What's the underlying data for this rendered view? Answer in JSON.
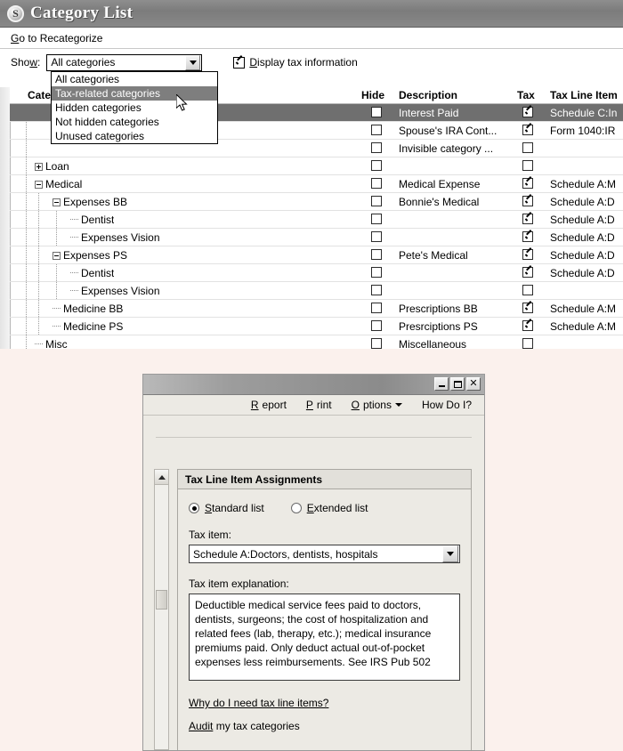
{
  "category_window": {
    "title": "Category List",
    "logo_icon": "quicken-s-logo-icon",
    "menu": {
      "recategorize_link": "Go to Recategorize"
    },
    "toolbar": {
      "show_label": "Show:",
      "show_value": "All categories",
      "display_tax_label": "Display tax information",
      "display_tax_checked": true,
      "dropdown_open": true,
      "dropdown_options": [
        "All categories",
        "Tax-related categories",
        "Hidden categories",
        "Not hidden categories",
        "Unused categories"
      ],
      "dropdown_selected": "Tax-related categories"
    },
    "grid": {
      "columns": [
        "Category",
        "Hide",
        "Description",
        "Tax",
        "Tax Line Item"
      ],
      "rows": [
        {
          "category": "",
          "indent": 0,
          "toggle": "none",
          "hide": false,
          "description": "Interest Paid",
          "tax": true,
          "tax_line_item": "Schedule C:In",
          "selected": true
        },
        {
          "category": "",
          "indent": 1,
          "toggle": "none",
          "hide": false,
          "description": "Spouse's IRA Cont...",
          "tax": true,
          "tax_line_item": "Form 1040:IR",
          "selected": false
        },
        {
          "category": "",
          "indent": 1,
          "toggle": "none",
          "hide": false,
          "description": "Invisible category ...",
          "tax": false,
          "tax_line_item": "",
          "selected": false
        },
        {
          "category": "Loan",
          "indent": 1,
          "toggle": "plus",
          "hide": false,
          "description": "",
          "tax": false,
          "tax_line_item": "",
          "selected": false
        },
        {
          "category": "Medical",
          "indent": 1,
          "toggle": "minus",
          "hide": false,
          "description": "Medical Expense",
          "tax": true,
          "tax_line_item": "Schedule A:M",
          "selected": false
        },
        {
          "category": "Expenses BB",
          "indent": 2,
          "toggle": "minus",
          "hide": false,
          "description": "Bonnie's Medical",
          "tax": true,
          "tax_line_item": "Schedule A:D",
          "selected": false
        },
        {
          "category": "Dentist",
          "indent": 3,
          "toggle": "leaf",
          "hide": false,
          "description": "",
          "tax": true,
          "tax_line_item": "Schedule A:D",
          "selected": false
        },
        {
          "category": "Expenses Vision",
          "indent": 3,
          "toggle": "leaf-last",
          "hide": false,
          "description": "",
          "tax": true,
          "tax_line_item": "Schedule A:D",
          "selected": false
        },
        {
          "category": "Expenses PS",
          "indent": 2,
          "toggle": "minus",
          "hide": false,
          "description": "Pete's Medical",
          "tax": true,
          "tax_line_item": "Schedule A:D",
          "selected": false
        },
        {
          "category": "Dentist",
          "indent": 3,
          "toggle": "leaf",
          "hide": false,
          "description": "",
          "tax": true,
          "tax_line_item": "Schedule A:D",
          "selected": false
        },
        {
          "category": "Expenses Vision",
          "indent": 3,
          "toggle": "leaf-last",
          "hide": false,
          "description": "",
          "tax": false,
          "tax_line_item": "",
          "selected": false
        },
        {
          "category": "Medicine BB",
          "indent": 2,
          "toggle": "leaf",
          "hide": false,
          "description": "Prescriptions BB",
          "tax": true,
          "tax_line_item": "Schedule A:M",
          "selected": false
        },
        {
          "category": "Medicine PS",
          "indent": 2,
          "toggle": "leaf-last",
          "hide": false,
          "description": "Presrciptions PS",
          "tax": true,
          "tax_line_item": "Schedule A:M",
          "selected": false
        },
        {
          "category": "Misc",
          "indent": 1,
          "toggle": "leaf",
          "hide": false,
          "description": "Miscellaneous",
          "tax": false,
          "tax_line_item": "",
          "selected": false
        }
      ]
    }
  },
  "tax_window": {
    "window_buttons": {
      "minimize": "minimize-icon",
      "maximize": "maximize-icon",
      "close": "close-icon"
    },
    "menu": {
      "report": "Report",
      "print": "Print",
      "options": "Options",
      "how_do_i": "How Do I?"
    },
    "group_title": "Tax Line Item Assignments",
    "list_mode": {
      "standard_label": "Standard list",
      "extended_label": "Extended list",
      "selected": "Standard list"
    },
    "tax_item": {
      "label": "Tax item:",
      "value": "Schedule A:Doctors, dentists, hospitals"
    },
    "explanation": {
      "label": "Tax item explanation:",
      "text": "Deductible medical service fees paid to doctors, dentists, surgeons; the cost of hospitalization and related fees (lab, therapy, etc.); medical insurance premiums paid.  Only deduct actual out-of-pocket expenses less reimbursements. See IRS Pub 502"
    },
    "links": {
      "why_link": "Why do I need tax line items?",
      "audit_link_underlined": "Audit",
      "audit_link_rest": " my tax categories"
    }
  },
  "colors": {
    "desktop_background": "#fbf1ed",
    "titlebar": "#7c7c7c",
    "selection": "#6f6f6f",
    "dropdown_selection": "#7e7e7e",
    "dialog_face": "#eceae4"
  }
}
